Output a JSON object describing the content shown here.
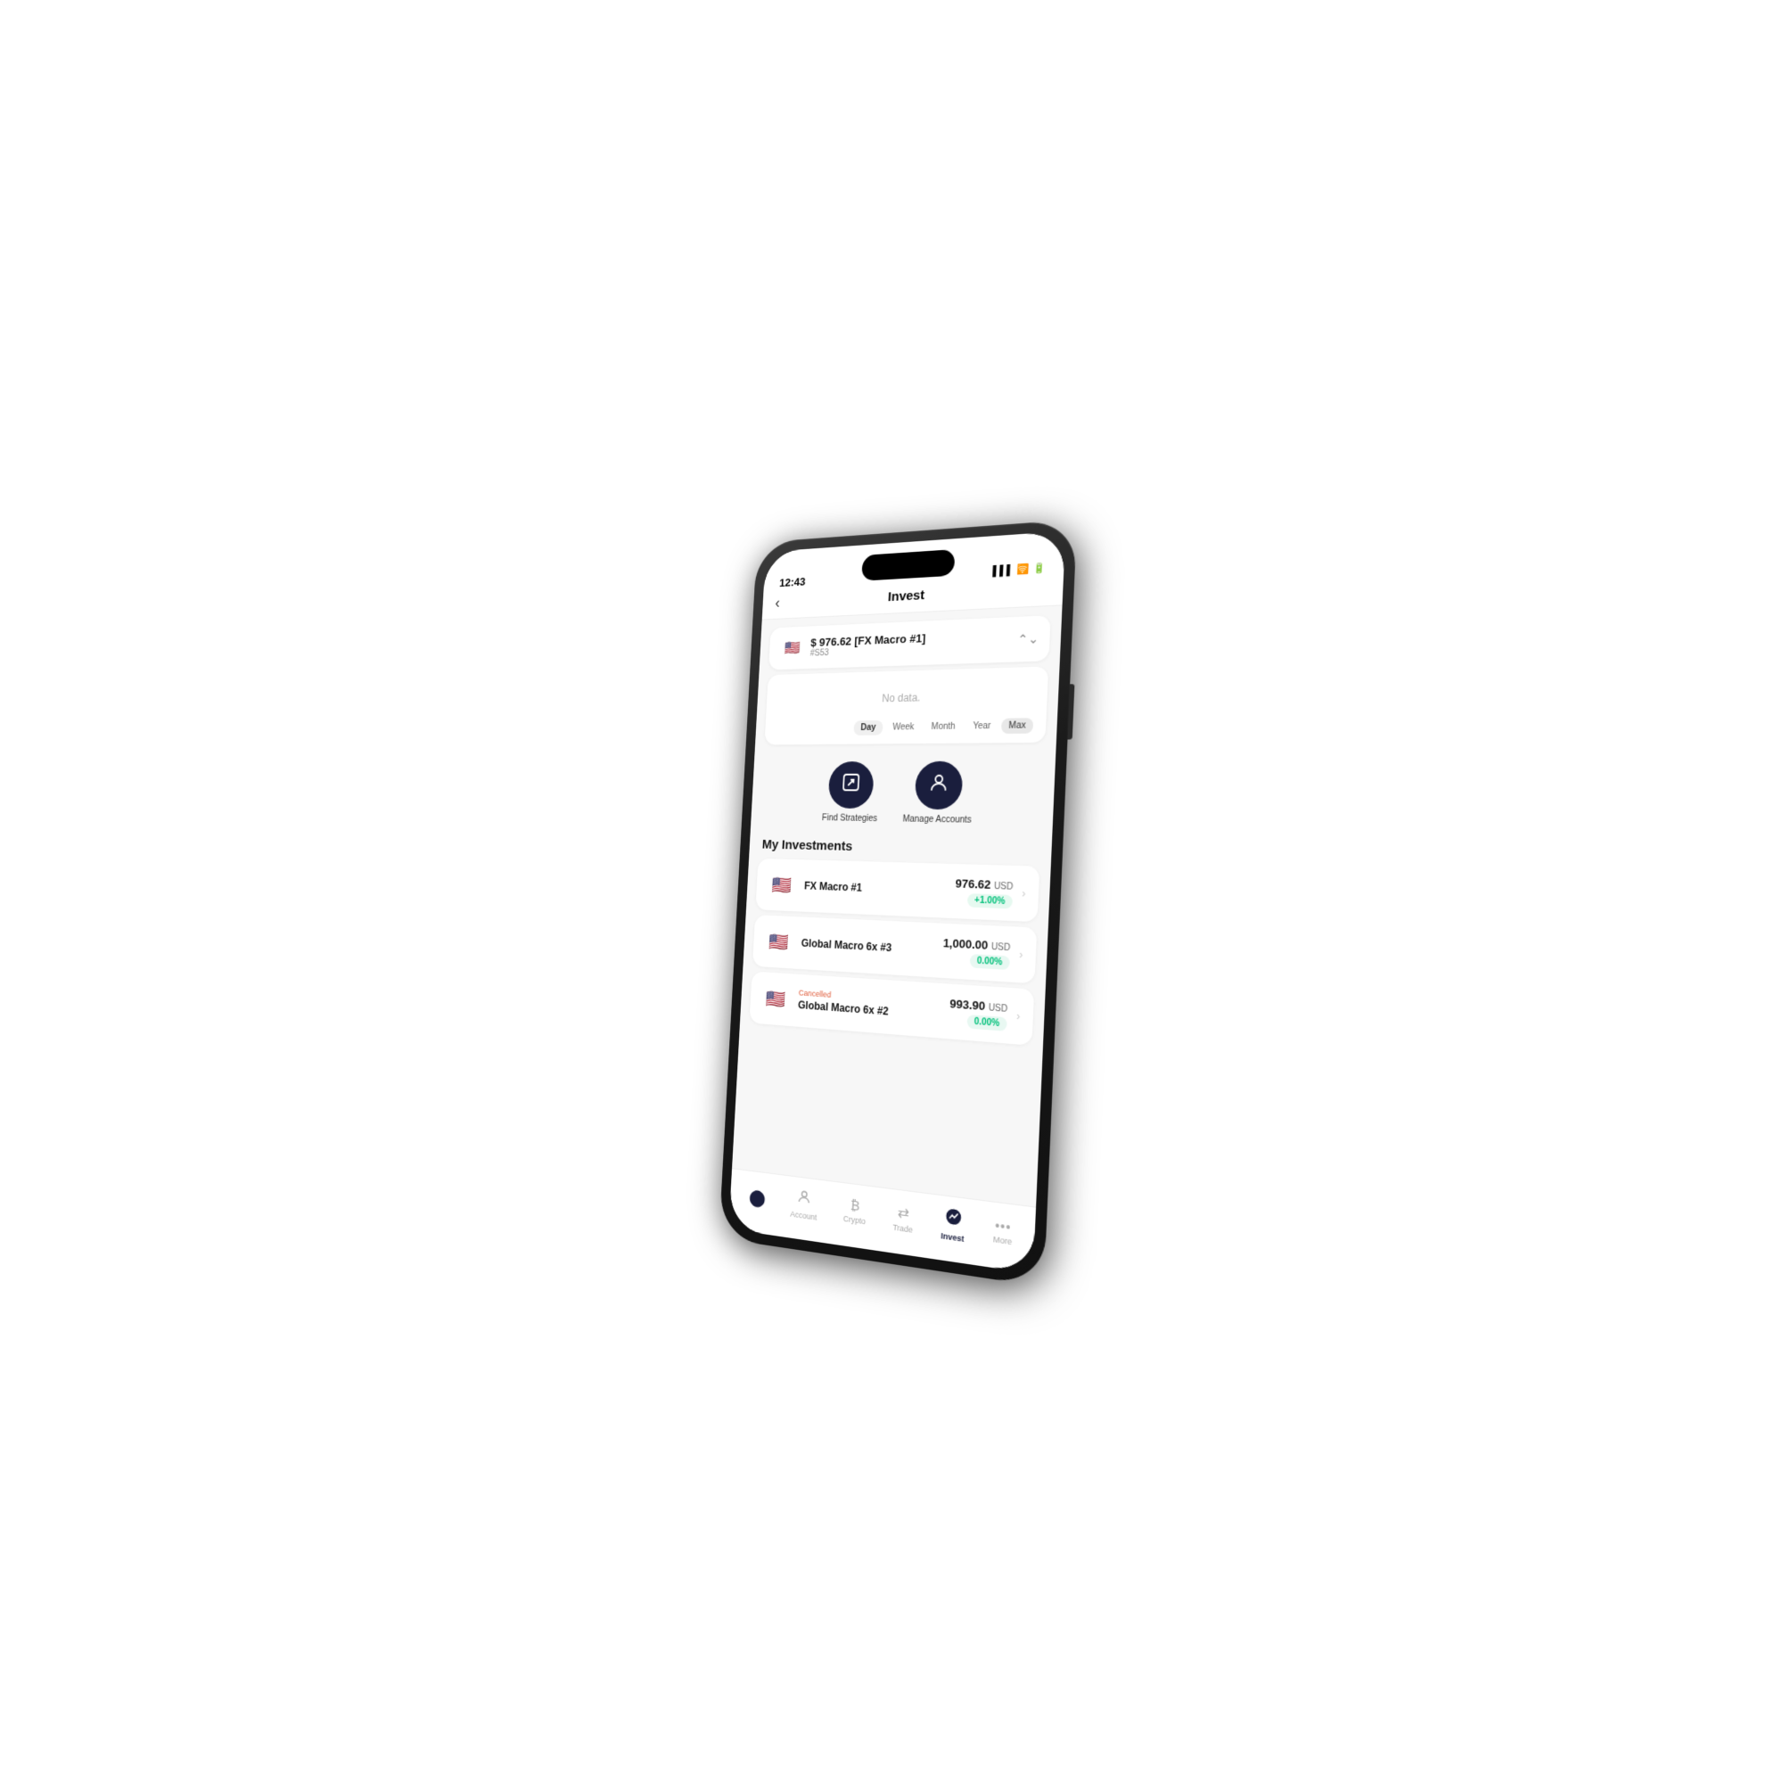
{
  "device": {
    "time": "12:43",
    "title": "Invest"
  },
  "account": {
    "name": "$ 976.62 [FX Macro #1]",
    "id": "#S53",
    "flag": "🇺🇸"
  },
  "chart": {
    "no_data_text": "No data.",
    "time_filters": [
      "Day",
      "Week",
      "Month",
      "Year",
      "Max"
    ],
    "active_filter": "Day"
  },
  "actions": [
    {
      "id": "find-strategies",
      "label": "Find Strategies",
      "icon": "↗"
    },
    {
      "id": "manage-accounts",
      "label": "Manage Accounts",
      "icon": "👤"
    }
  ],
  "investments": {
    "section_title": "My Investments",
    "items": [
      {
        "name": "FX Macro #1",
        "cancelled": "",
        "amount": "976.62",
        "currency": "USD",
        "change": "+1.00%",
        "change_type": "positive",
        "flag": "🇺🇸"
      },
      {
        "name": "Global Macro 6x #3",
        "cancelled": "",
        "amount": "1,000.00",
        "currency": "USD",
        "change": "0.00%",
        "change_type": "neutral",
        "flag": "🇺🇸"
      },
      {
        "name": "Global Macro 6x #2",
        "cancelled": "Cancelled",
        "amount": "993.90",
        "currency": "USD",
        "change": "0.00%",
        "change_type": "neutral",
        "flag": "🇺🇸"
      }
    ]
  },
  "bottom_nav": [
    {
      "id": "logo",
      "icon": "●",
      "label": "",
      "is_logo": true
    },
    {
      "id": "account",
      "icon": "👤",
      "label": "Account"
    },
    {
      "id": "crypto",
      "icon": "₿",
      "label": "Crypto"
    },
    {
      "id": "trade",
      "icon": "⇄",
      "label": "Trade"
    },
    {
      "id": "invest",
      "icon": "◕",
      "label": "Invest",
      "active": true
    },
    {
      "id": "more",
      "icon": "•••",
      "label": "More"
    }
  ]
}
